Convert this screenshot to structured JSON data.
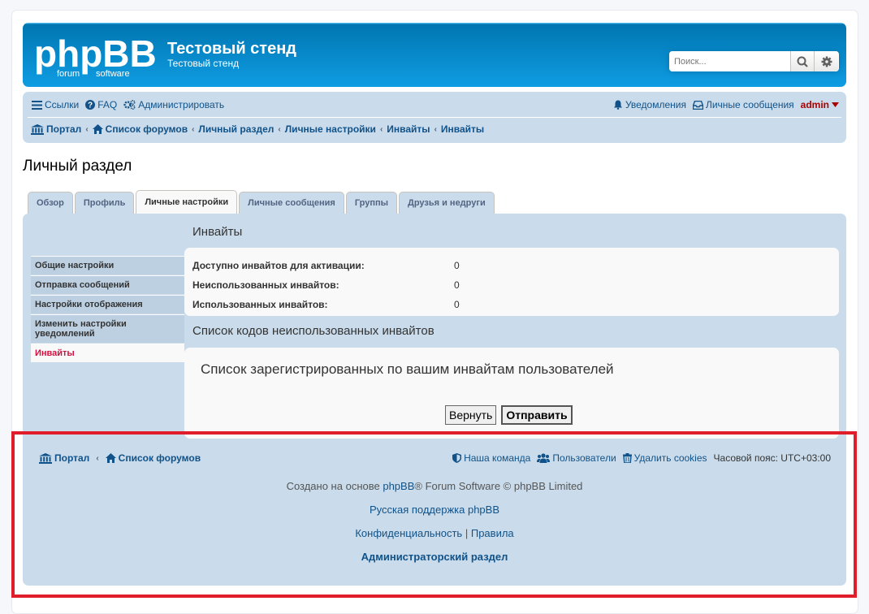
{
  "header": {
    "logo_text": "phpBB",
    "logo_sub1": "forum",
    "logo_sub2": "software",
    "site_title": "Тестовый стенд",
    "site_description": "Тестовый стенд",
    "search_placeholder": "Поиск..."
  },
  "navbar": {
    "links": [
      {
        "label": "Ссылки",
        "icon": "menu-icon"
      },
      {
        "label": "FAQ",
        "icon": "help-icon"
      },
      {
        "label": "Администрировать",
        "icon": "cogs-icon"
      }
    ],
    "notifications": "Уведомления",
    "messages": "Личные сообщения",
    "user": "admin"
  },
  "breadcrumbs": [
    "Портал",
    "Список форумов",
    "Личный раздел",
    "Личные настройки",
    "Инвайты",
    "Инвайты"
  ],
  "page_title": "Личный раздел",
  "tabs": [
    {
      "label": "Обзор",
      "active": false
    },
    {
      "label": "Профиль",
      "active": false
    },
    {
      "label": "Личные настройки",
      "active": true
    },
    {
      "label": "Личные сообщения",
      "active": false
    },
    {
      "label": "Группы",
      "active": false
    },
    {
      "label": "Друзья и недруги",
      "active": false
    }
  ],
  "sidemenu": [
    {
      "label": "Общие настройки",
      "active": false
    },
    {
      "label": "Отправка сообщений",
      "active": false
    },
    {
      "label": "Настройки отображения",
      "active": false
    },
    {
      "label": "Изменить настройки уведомлений",
      "active": false
    },
    {
      "label": "Инвайты",
      "active": true
    }
  ],
  "content": {
    "heading": "Инвайты",
    "stats": [
      {
        "label": "Доступно инвайтов для активации:",
        "value": "0"
      },
      {
        "label": "Неиспользованных инвайтов:",
        "value": "0"
      },
      {
        "label": "Использованных инвайтов:",
        "value": "0"
      }
    ],
    "unused_heading": "Список кодов неиспользованных инвайтов",
    "registered_heading": "Список зарегистрированных по вашим инвайтам пользователей",
    "reset_label": "Вернуть",
    "submit_label": "Отправить"
  },
  "footer": {
    "portal": "Портал",
    "forum_list": "Список форумов",
    "team": "Наша команда",
    "members": "Пользователи",
    "delete_cookies": "Удалить cookies",
    "timezone_label": "Часовой пояс:",
    "timezone_value": "UTC+03:00",
    "powered_prefix": "Создано на основе",
    "powered_link": "phpBB",
    "powered_suffix": "® Forum Software © phpBB Limited",
    "support": "Русская поддержка phpBB",
    "privacy": "Конфиденциальность",
    "separator": "|",
    "terms": "Правила",
    "admin_panel": "Администраторский раздел"
  },
  "colors": {
    "header_bg": "#12a3eb",
    "nav_bg": "#cadceb",
    "link": "#105289",
    "user": "#aa0000",
    "active_side": "#d31141",
    "highlight_frame": "#e01d2a"
  }
}
